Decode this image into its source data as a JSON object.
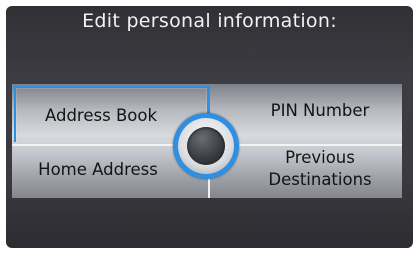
{
  "screen": {
    "title": "Edit personal information:"
  },
  "menu": {
    "address_book": "Address Book",
    "pin_number": "PIN Number",
    "home_address": "Home Address",
    "previous_destinations_line1": "Previous",
    "previous_destinations_line2": "Destinations",
    "selected_item": "Address Book"
  },
  "colors": {
    "selection_highlight": "#2f8fe0",
    "background": "#38383e",
    "panel": "#c8cace"
  },
  "icons": {
    "center_knob": "interface-dial-icon"
  }
}
